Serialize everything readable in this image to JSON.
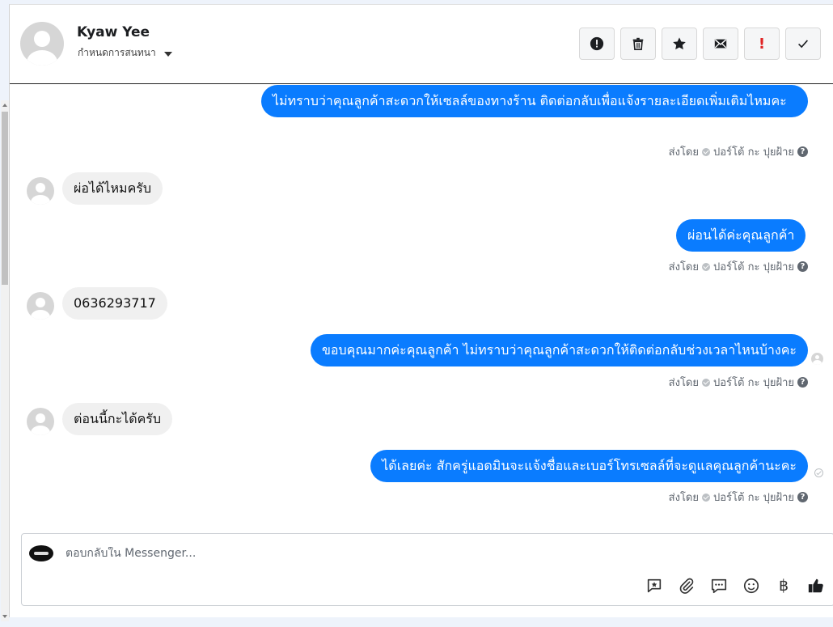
{
  "header": {
    "contact_name": "Kyaw Yee",
    "assign_label": "กำหนดการสนทนา",
    "actions": [
      {
        "name": "mark-spam-button",
        "icon": "exclamation-circle-icon"
      },
      {
        "name": "delete-button",
        "icon": "trash-icon"
      },
      {
        "name": "star-button",
        "icon": "star-icon"
      },
      {
        "name": "mark-unread-button",
        "icon": "envelope-icon"
      },
      {
        "name": "follow-up-button",
        "icon": "red-exclamation-icon",
        "glyph": "!"
      },
      {
        "name": "mark-done-button",
        "icon": "check-icon"
      }
    ]
  },
  "messages": [
    {
      "direction": "out",
      "text": "ไม่ทราบว่าคุณลูกค้าสะดวกให้เซลล์ของทางร้าน ติดต่อกลับเพื่อแจ้งรายละเอียดเพิ่มเติมไหมคะ",
      "sent_by_label": "ส่งโดย",
      "sender": "ปอร์โต้ กะ ปุยฝ้าย"
    },
    {
      "direction": "in",
      "text": "ผ่อได้ไหมครับ"
    },
    {
      "direction": "out",
      "text": "ผ่อนได้ค่ะคุณลูกค้า",
      "sent_by_label": "ส่งโดย",
      "sender": "ปอร์โต้ กะ ปุยฝ้าย"
    },
    {
      "direction": "in",
      "text": "0636293717"
    },
    {
      "direction": "out",
      "text": "ขอบคุณมากค่ะคุณลูกค้า ไม่ทราบว่าคุณลูกค้าสะดวกให้ติดต่อกลับช่วงเวลาไหนบ้างคะ",
      "sent_by_label": "ส่งโดย",
      "sender": "ปอร์โต้ กะ ปุยฝ้าย"
    },
    {
      "direction": "in",
      "text": "ต่อนนี้กะได้ครับ"
    },
    {
      "direction": "out",
      "text": "ได้เลยค่ะ สักครู่แอดมินจะแจ้งชื่อและเบอร์โทรเซลล์ที่จะดูแลคุณลูกค้านะคะ",
      "sent_by_label": "ส่งโดย",
      "sender": "ปอร์โต้ กะ ปุยฝ้าย"
    }
  ],
  "composer": {
    "placeholder": "ตอบกลับใน Messenger...",
    "tools": [
      "saved-reply-icon",
      "attachment-icon",
      "chat-bubble-icon",
      "emoji-icon",
      "baht-icon",
      "thumbs-up-icon"
    ],
    "currency_glyph": "฿"
  },
  "colors": {
    "outgoing_bubble": "#0a7cff",
    "incoming_bubble": "#f0f0f0",
    "follow_up_red": "#e02424"
  }
}
